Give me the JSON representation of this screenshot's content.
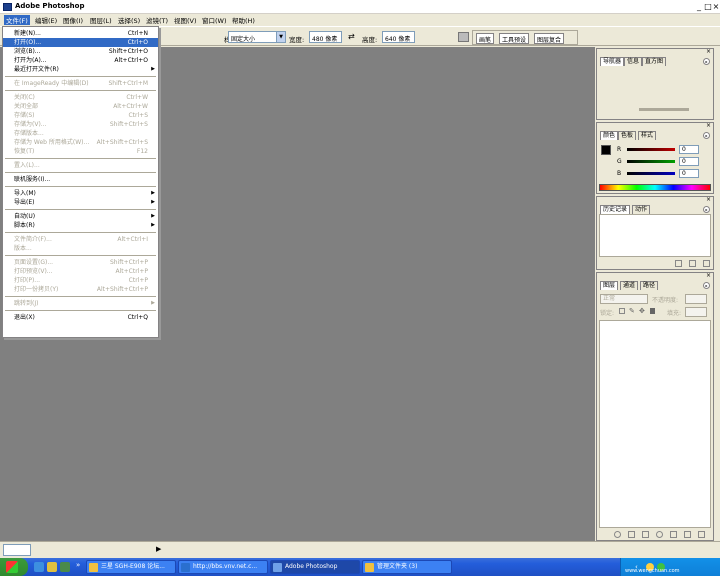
{
  "app": {
    "title": "Adobe Photoshop",
    "window_controls": [
      "_",
      "□",
      "×"
    ]
  },
  "menubar": {
    "items": [
      {
        "label": "文件(F)",
        "active": true
      },
      {
        "label": "编辑(E)"
      },
      {
        "label": "图像(I)"
      },
      {
        "label": "图层(L)"
      },
      {
        "label": "选择(S)"
      },
      {
        "label": "滤镜(T)"
      },
      {
        "label": "视图(V)"
      },
      {
        "label": "窗口(W)"
      },
      {
        "label": "帮助(H)"
      }
    ]
  },
  "options_bar": {
    "style_label": "样式:",
    "style_value": "固定大小",
    "width_label": "宽度:",
    "width_value": "480 像素",
    "swap_icon": "⇄",
    "height_label": "高度:",
    "height_value": "640 像素",
    "tabs": [
      "画笔",
      "工具预设",
      "图层复合"
    ]
  },
  "file_menu": {
    "items": [
      {
        "label": "新建(N)...",
        "shortcut": "Ctrl+N"
      },
      {
        "label": "打开(O)...",
        "shortcut": "Ctrl+O",
        "highlight": true
      },
      {
        "label": "浏览(B)...",
        "shortcut": "Shift+Ctrl+O"
      },
      {
        "label": "打开为(A)...",
        "shortcut": "Alt+Ctrl+O"
      },
      {
        "label": "最近打开文件(R)",
        "submenu": true
      },
      {
        "sep": true
      },
      {
        "label": "在 ImageReady 中编辑(D)",
        "shortcut": "Shift+Ctrl+M",
        "disabled": true
      },
      {
        "sep": true
      },
      {
        "label": "关闭(C)",
        "shortcut": "Ctrl+W",
        "disabled": true
      },
      {
        "label": "关闭全部",
        "shortcut": "Alt+Ctrl+W",
        "disabled": true
      },
      {
        "label": "存储(S)",
        "shortcut": "Ctrl+S",
        "disabled": true
      },
      {
        "label": "存储为(V)...",
        "shortcut": "Shift+Ctrl+S",
        "disabled": true
      },
      {
        "label": "存储版本...",
        "disabled": true
      },
      {
        "label": "存储为 Web 所用格式(W)...",
        "shortcut": "Alt+Shift+Ctrl+S",
        "disabled": true
      },
      {
        "label": "恢复(T)",
        "shortcut": "F12",
        "disabled": true
      },
      {
        "sep": true
      },
      {
        "label": "置入(L)...",
        "disabled": true
      },
      {
        "sep": true
      },
      {
        "label": "联机服务(I)..."
      },
      {
        "sep": true
      },
      {
        "label": "导入(M)",
        "submenu": true
      },
      {
        "label": "导出(E)",
        "submenu": true
      },
      {
        "sep": true
      },
      {
        "label": "自动(U)",
        "submenu": true
      },
      {
        "label": "脚本(R)",
        "submenu": true
      },
      {
        "sep": true
      },
      {
        "label": "文件简介(F)...",
        "shortcut": "Alt+Ctrl+I",
        "disabled": true
      },
      {
        "label": "版本...",
        "disabled": true
      },
      {
        "sep": true
      },
      {
        "label": "页面设置(G)...",
        "shortcut": "Shift+Ctrl+P",
        "disabled": true
      },
      {
        "label": "打印预览(V)...",
        "shortcut": "Alt+Ctrl+P",
        "disabled": true
      },
      {
        "label": "打印(P)...",
        "shortcut": "Ctrl+P",
        "disabled": true
      },
      {
        "label": "打印一份拷贝(Y)",
        "shortcut": "Alt+Shift+Ctrl+P",
        "disabled": true
      },
      {
        "sep": true
      },
      {
        "label": "跳转到(J)",
        "submenu": true,
        "disabled": true
      },
      {
        "sep": true
      },
      {
        "label": "退出(X)",
        "shortcut": "Ctrl+Q"
      }
    ]
  },
  "panels": {
    "navigator": {
      "tabs": [
        "导航器",
        "信息",
        "直方图"
      ]
    },
    "color": {
      "tabs": [
        "颜色",
        "色板",
        "样式"
      ],
      "channels": [
        {
          "name": "R",
          "value": "0",
          "color": "#c00000"
        },
        {
          "name": "G",
          "value": "0",
          "color": "#008000"
        },
        {
          "name": "B",
          "value": "0",
          "color": "#0000c0"
        }
      ]
    },
    "history": {
      "tabs": [
        "历史记录",
        "动作"
      ]
    },
    "layers": {
      "tabs": [
        "图层",
        "通道",
        "路径"
      ],
      "blend_mode": "正常",
      "opacity_label": "不透明度:",
      "lock_label": "锁定:",
      "fill_label": "填充:"
    }
  },
  "taskbar": {
    "start_label": "",
    "buttons": [
      {
        "label": "三星 SGH-E908 论坛...",
        "color": "#f0c040"
      },
      {
        "label": "http://bbs.vnv.net.c...",
        "color": "#2a6fcf"
      },
      {
        "label": "Adobe Photoshop",
        "color": "#1c3f8c",
        "active": true
      },
      {
        "label": "管理文件夹 (3)",
        "color": "#f0c040"
      }
    ],
    "tray_text": "www.wengchuan.com"
  },
  "colors": {
    "workspace": "#808080",
    "highlight": "#316ac5",
    "chrome": "#ece9d8"
  }
}
